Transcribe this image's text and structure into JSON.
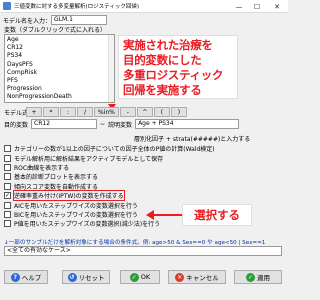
{
  "window": {
    "title": "三値変数に対する多変量解析(ロジスティック回帰)",
    "min_glyph": "—",
    "max_glyph": "☐",
    "close_glyph": "✕"
  },
  "model": {
    "name_label": "モデル名を入力：",
    "name_value": "GLM.1"
  },
  "variables": {
    "label": "変数（ダブルクリックで式に入れる）",
    "items": [
      "Age",
      "CR12",
      "PS34",
      "DaysPFS",
      "CompRisk",
      "PFS",
      "Progression",
      "NonProgressionDeath"
    ]
  },
  "callout_top": {
    "lines": [
      "実施された治療を",
      "目的変数にした",
      "多重ロジスティック",
      "回帰を実施する"
    ]
  },
  "formula": {
    "label": "モデル式：",
    "operators": [
      "+",
      "*",
      ":",
      "/",
      "%in%",
      "-",
      "^",
      "(",
      ")"
    ],
    "dep_label": "目的変数",
    "dep_value": "CR12",
    "tilde": "~",
    "indep_label": "説明変数",
    "indep_value": "Age + PS34"
  },
  "strata_hint": "層別化因子 + strata(#####)と入力する",
  "options": [
    {
      "label": "カテゴリーの数が1以上の因子についての因子全体のP値の計算(Wald検定)",
      "checked": false
    },
    {
      "label": "モデル解析用に解析結果をアクティブモデルとして保存",
      "checked": false
    },
    {
      "label": "ROC曲線を表示する",
      "checked": false
    },
    {
      "label": "基本的診断プロットを表示する",
      "checked": false
    },
    {
      "label": "傾向スコア変数を自動作成する",
      "checked": false
    },
    {
      "label": "逆確率重み付け(IPTW)の変数を作成する",
      "checked": true,
      "highlighted": true
    },
    {
      "label": "AICを用いたステップワイズの変数選択を行う",
      "checked": false
    },
    {
      "label": "BICを用いたステップワイズの変数選択を行う",
      "checked": false
    },
    {
      "label": "P値を用いたステップワイズの変数選択(減少法)を行う",
      "checked": false
    }
  ],
  "callout_bottom": "選択する",
  "subset": {
    "label": "↓一部のサンプルだけを解析対象にする場合の条件式。例: age>50 & Sex==0 や age<50 | Sex==1",
    "value": "<全ての有効なケース>"
  },
  "buttons": {
    "help": "ヘルプ",
    "reset": "リセット",
    "ok": "OK",
    "cancel": "キャンセル",
    "apply": "適用"
  },
  "colors": {
    "callout_red": "#ea1c24",
    "help_icon": "#2a6ad4",
    "ok_icon": "#2a9d3a",
    "cancel_icon": "#d93a2b",
    "apply_icon": "#2a9d3a",
    "reset_icon": "#2a6ad4"
  }
}
